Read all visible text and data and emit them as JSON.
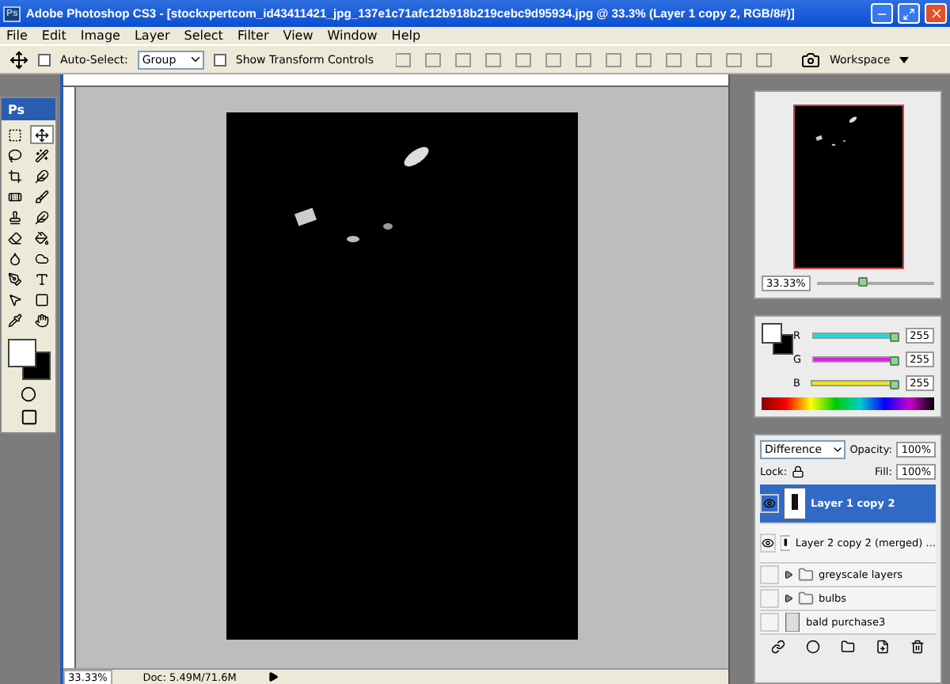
{
  "window": {
    "title": "Adobe Photoshop CS3 - [stockxpertcom_id43411421_jpg_137e1c71afc12b918b219cebc9d95934.jpg @ 33.3% (Layer 1 copy 2, RGB/8#)]",
    "app_badge": "Ps"
  },
  "menu": [
    "File",
    "Edit",
    "Image",
    "Layer",
    "Select",
    "Filter",
    "View",
    "Window",
    "Help"
  ],
  "options_bar": {
    "auto_select": {
      "label": "Auto-Select:",
      "checked": false
    },
    "auto_select_target": "Group",
    "show_transform": {
      "label": "Show Transform Controls",
      "checked": false
    },
    "workspace": "Workspace"
  },
  "toolbox": {
    "badge": "Ps",
    "tools": [
      {
        "selected": false
      },
      {
        "selected": true
      },
      {
        "selected": false
      },
      {
        "selected": false
      },
      {
        "selected": false
      },
      {
        "selected": false
      },
      {
        "selected": false
      },
      {
        "selected": false
      },
      {
        "selected": false
      },
      {
        "selected": false
      },
      {
        "selected": false
      },
      {
        "selected": false
      },
      {
        "selected": false
      },
      {
        "selected": false
      },
      {
        "selected": false
      },
      {
        "selected": false
      },
      {
        "selected": false
      },
      {
        "selected": false
      },
      {
        "selected": false
      },
      {
        "selected": false
      }
    ]
  },
  "document": {
    "status_zoom": "33.33%",
    "status_info": "Doc: 5.49M/71.6M"
  },
  "navigator": {
    "zoom": "33.33%",
    "level": 0.4
  },
  "color": {
    "channels": [
      {
        "label": "R",
        "value": "255",
        "level": 1,
        "color": "#22d8d8"
      },
      {
        "label": "G",
        "value": "255",
        "level": 1,
        "color": "#d820d8"
      },
      {
        "label": "B",
        "value": "255",
        "level": 1,
        "color": "#e8e820"
      }
    ]
  },
  "layers": {
    "blend_mode": "Difference",
    "opacity_label": "Opacity:",
    "opacity": "100%",
    "lock_label": "Lock:",
    "fill_label": "Fill:",
    "fill": "100%",
    "items": [
      {
        "kind": "layer",
        "name": "Layer 1 copy 2",
        "visible": true,
        "selected": true
      },
      {
        "kind": "layer",
        "name": "Layer 2 copy 2 (merged) ...",
        "visible": true,
        "selected": false
      },
      {
        "kind": "group",
        "name": "greyscale layers",
        "visible": false,
        "selected": false,
        "expanded": false
      },
      {
        "kind": "group",
        "name": "bulbs",
        "visible": false,
        "selected": false,
        "expanded": false
      },
      {
        "kind": "transparent",
        "name": "bald purchase3",
        "visible": false,
        "selected": false
      }
    ]
  }
}
